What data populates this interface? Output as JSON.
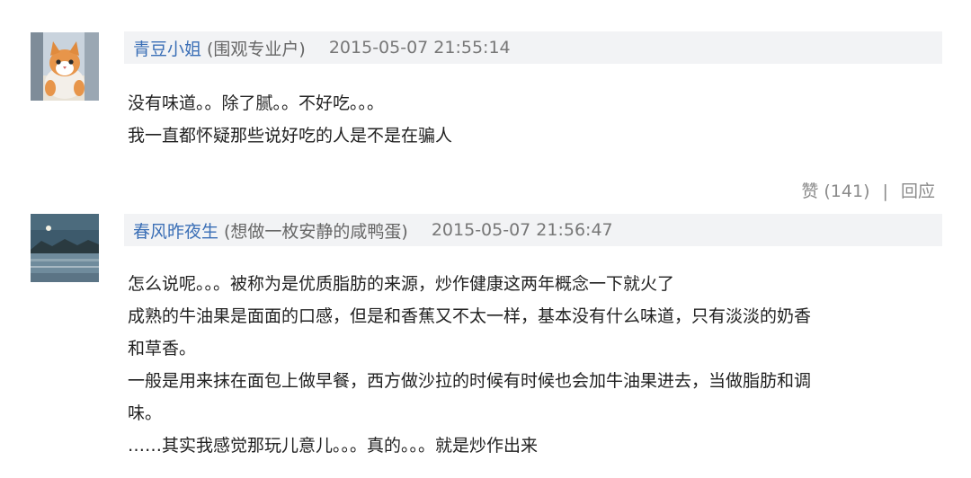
{
  "comments": [
    {
      "user": "青豆小姐",
      "group": "(围观专业户)",
      "timestamp": "2015-05-07 21:55:14",
      "avatar_icon": "cat-avatar",
      "lines": [
        "没有味道。。除了腻。。不好吃。。。",
        "我一直都怀疑那些说好吃的人是不是在骗人"
      ],
      "like_label": "赞",
      "like_count": "(141)",
      "reply_label": "回应"
    },
    {
      "user": "春风昨夜生",
      "group": "(想做一枚安静的咸鸭蛋)",
      "timestamp": "2015-05-07 21:56:47",
      "avatar_icon": "lake-landscape-avatar",
      "lines": [
        "怎么说呢。。。被称为是优质脂肪的来源，炒作健康这两年概念一下就火了",
        "成熟的牛油果是面面的口感，但是和香蕉又不太一样，基本没有什么味道，只有淡淡的奶香",
        "和草香。",
        "一般是用来抹在面包上做早餐，西方做沙拉的时候有时候也会加牛油果进去，当做脂肪和调",
        "味。",
        "……其实我感觉那玩儿意儿。。。真的。。。就是炒作出来"
      ]
    }
  ],
  "colors": {
    "username": "#3b6fb6",
    "header_bg": "#f2f3f5",
    "body_text": "#222222",
    "meta_text": "#777777"
  }
}
